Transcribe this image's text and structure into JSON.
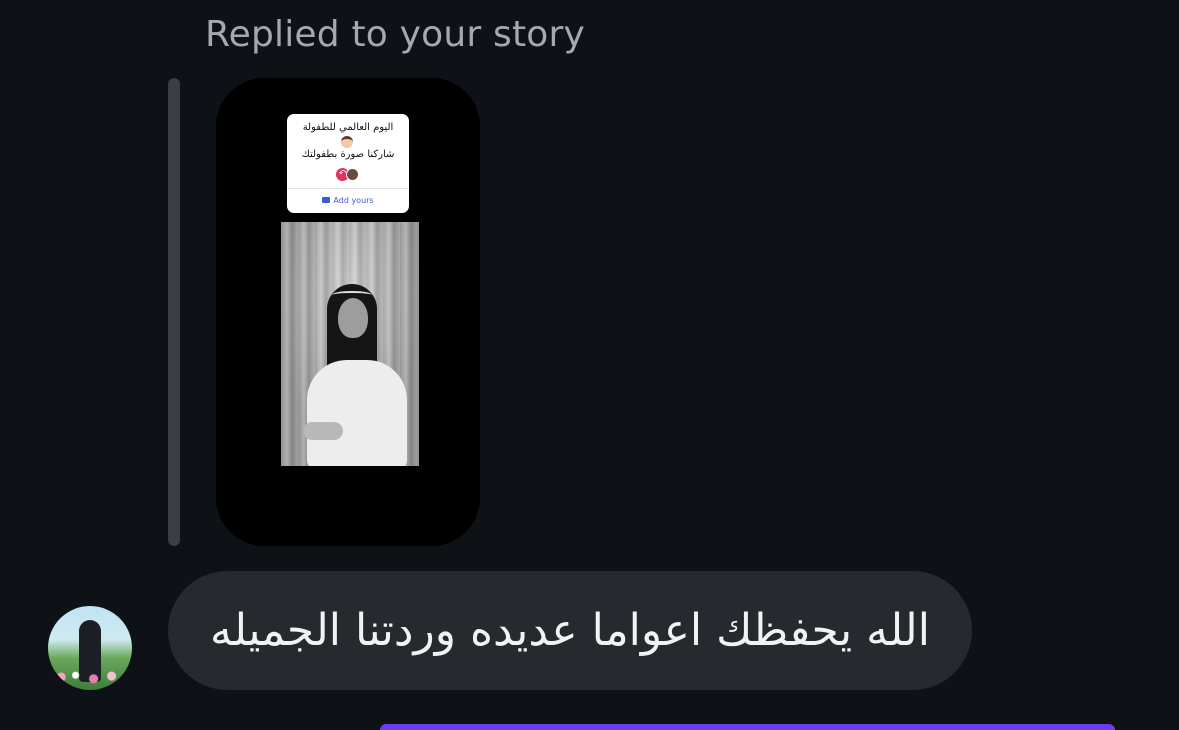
{
  "header": {
    "reply_label": "Replied to your story"
  },
  "story_preview": {
    "sticker": {
      "line1": "اليوم العالمي للطفولة",
      "line2": "شاركنا صورة بطفولتك",
      "add_label": "Add yours"
    }
  },
  "message": {
    "text": "الله يحفظك اعواما عديده وردتنا الجميله"
  },
  "colors": {
    "background": "#0e1116",
    "bubble": "#262a2f",
    "accent": "#6b3cf0"
  }
}
